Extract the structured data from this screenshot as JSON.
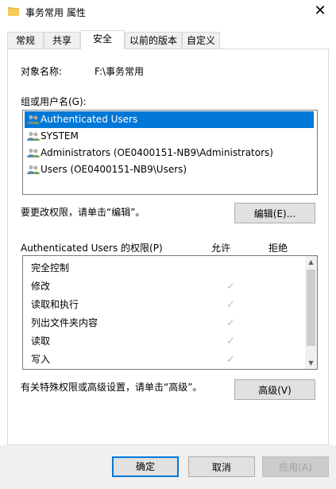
{
  "window": {
    "title": "事务常用 属性",
    "close_glyph": "✕"
  },
  "tabs": [
    {
      "label": "常规"
    },
    {
      "label": "共享"
    },
    {
      "label": "安全",
      "active": true
    },
    {
      "label": "以前的版本"
    },
    {
      "label": "自定义"
    }
  ],
  "security": {
    "object_label": "对象名称:",
    "object_value": "F:\\事务常用",
    "group_label": "组或用户名(G):",
    "users": [
      {
        "name": "Authenticated Users",
        "selected": true
      },
      {
        "name": "SYSTEM"
      },
      {
        "name": "Administrators (OE0400151-NB9\\Administrators)"
      },
      {
        "name": "Users (OE0400151-NB9\\Users)"
      }
    ],
    "edit_hint": "要更改权限，请单击“编辑”。",
    "edit_button": "编辑(E)...",
    "perm_header": "Authenticated Users 的权限(P)",
    "allow_header": "允许",
    "deny_header": "拒绝",
    "permissions": [
      {
        "name": "完全控制",
        "allow": ""
      },
      {
        "name": "修改",
        "allow": "✓"
      },
      {
        "name": "读取和执行",
        "allow": "✓"
      },
      {
        "name": "列出文件夹内容",
        "allow": "✓"
      },
      {
        "name": "读取",
        "allow": "✓"
      },
      {
        "name": "写入",
        "allow": "✓"
      }
    ],
    "advanced_hint": "有关特殊权限或高级设置，请单击“高级”。",
    "advanced_button": "高级(V)"
  },
  "buttons": {
    "ok": "确定",
    "cancel": "取消",
    "apply": "应用(A)"
  },
  "colors": {
    "selection": "#0078d7",
    "check": "#bdbdbd",
    "folder": "#e8b84a"
  }
}
